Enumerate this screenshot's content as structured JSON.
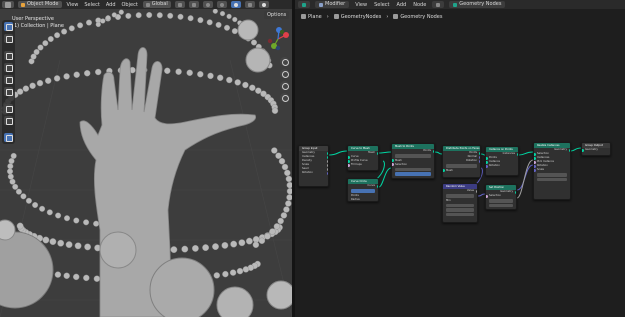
{
  "viewport": {
    "header": {
      "mode": "Object Mode",
      "menus": [
        "View",
        "Select",
        "Add",
        "Object"
      ],
      "orientation": "Global"
    },
    "overlay": {
      "view_name": "User Perspective",
      "collection": "(1) Collection | Plane"
    },
    "options_label": "Options"
  },
  "node_editor": {
    "header": {
      "editor": "Modifier",
      "menus": [
        "View",
        "Select",
        "Add",
        "Node"
      ],
      "tree_name": "Geometry Nodes"
    },
    "breadcrumb": [
      "Plane",
      "GeometryNodes",
      "Geometry Nodes"
    ],
    "nodes": {
      "group_input": {
        "title": "Group Input",
        "rows": [
          "Geometry",
          "Instances",
          "Density",
          "Scale",
          "Seed",
          "Rotation"
        ]
      },
      "curve_to_mesh": {
        "title": "Curve to Mesh",
        "rows": [
          "Mesh",
          "Curve",
          "Profile Curve",
          "Fill Caps"
        ]
      },
      "curve_circle": {
        "title": "Curve Circle",
        "rows": [
          "Curve",
          "Points",
          "Radius"
        ]
      },
      "mesh_to_points": {
        "title": "Mesh to Points",
        "rows": [
          "Points",
          "Vertices",
          "Mesh",
          "Selection",
          "Position",
          "Radius"
        ]
      },
      "distribute": {
        "title": "Distribute Points on Faces",
        "rows": [
          "Points",
          "Normal",
          "Rotation",
          "Random",
          "Mesh"
        ]
      },
      "instance_on_points": {
        "title": "Instance on Points",
        "rows": [
          "Instances",
          "Points",
          "Instance",
          "Rotation"
        ]
      },
      "random_value": {
        "title": "Random Value",
        "rows": [
          "Value",
          "Float",
          "Min",
          "Max",
          "Seed"
        ]
      },
      "set_position": {
        "title": "Set Position",
        "rows": [
          "Geometry",
          "Selection",
          "Offset"
        ]
      },
      "realize": {
        "title": "Realize Instances",
        "rows": [
          "Geometry",
          "Selection",
          "Instances",
          "Pick Instance",
          "Rotation",
          "Scale"
        ]
      },
      "group_output": {
        "title": "Group Output",
        "rows": [
          "Geometry"
        ]
      }
    }
  }
}
